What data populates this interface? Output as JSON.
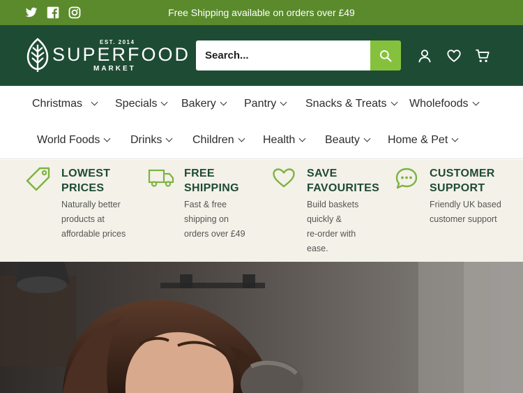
{
  "topbar": {
    "social": [
      {
        "icon": "twitter-icon"
      },
      {
        "icon": "facebook-icon"
      },
      {
        "icon": "instagram-icon"
      }
    ],
    "promo": "Free Shipping available on orders over £49"
  },
  "header": {
    "logo": {
      "est": "EST. 2014",
      "name": "SUPERFOOD",
      "sub": "MARKET"
    },
    "search": {
      "placeholder": "Search...",
      "value": ""
    },
    "icons": [
      "account-icon",
      "heart-icon",
      "cart-icon"
    ]
  },
  "nav": {
    "items": [
      {
        "label": "Christmas"
      },
      {
        "label": "Specials"
      },
      {
        "label": "Bakery"
      },
      {
        "label": "Pantry"
      },
      {
        "label": "Snacks & Treats"
      },
      {
        "label": "Wholefoods"
      },
      {
        "label": "World Foods"
      },
      {
        "label": "Drinks"
      },
      {
        "label": "Children"
      },
      {
        "label": "Health"
      },
      {
        "label": "Beauty"
      },
      {
        "label": "Home & Pet"
      }
    ]
  },
  "features": [
    {
      "icon": "price-tag-icon",
      "title": "LOWEST\nPRICES",
      "desc": "Naturally better\nproducts at\naffordable prices"
    },
    {
      "icon": "delivery-truck-icon",
      "title": "FREE\nSHIPPING",
      "desc": "Fast & free\nshipping on\norders over £49"
    },
    {
      "icon": "heart-outline-icon",
      "title": "SAVE\nFAVOURITES",
      "desc": "Build baskets\nquickly &\nre-order with\nease."
    },
    {
      "icon": "chat-bubble-icon",
      "title": "CUSTOMER\nSUPPORT",
      "desc": "Friendly UK based\ncustomer support"
    }
  ],
  "colors": {
    "topbar": "#5a8a2c",
    "header": "#1e4b34",
    "accent": "#86c13d",
    "features_bg": "#f4f1e8",
    "feature_title": "#1e4b34"
  }
}
